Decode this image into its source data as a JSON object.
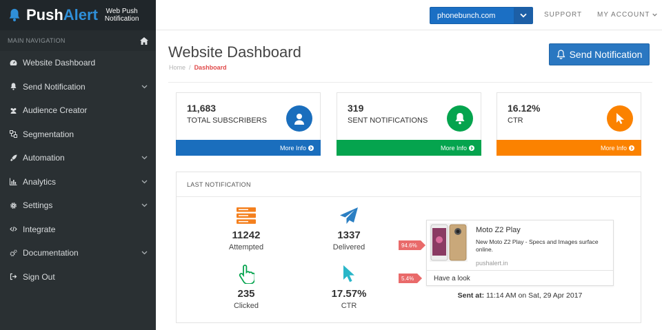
{
  "brand": {
    "push": "Push",
    "alert": "Alert",
    "tagline_1": "Web Push",
    "tagline_2": "Notification"
  },
  "nav": {
    "heading": "MAIN NAVIGATION",
    "items": [
      {
        "label": "Website Dashboard",
        "icon": "dashboard-icon"
      },
      {
        "label": "Send Notification",
        "icon": "bell-icon"
      },
      {
        "label": "Audience Creator",
        "icon": "users-icon"
      },
      {
        "label": "Segmentation",
        "icon": "segment-icon"
      },
      {
        "label": "Automation",
        "icon": "rocket-icon"
      },
      {
        "label": "Analytics",
        "icon": "bar-chart-icon"
      },
      {
        "label": "Settings",
        "icon": "gear-icon"
      },
      {
        "label": "Integrate",
        "icon": "code-icon"
      },
      {
        "label": "Documentation",
        "icon": "cogs-icon"
      },
      {
        "label": "Sign Out",
        "icon": "sign-out-icon"
      }
    ]
  },
  "topbar": {
    "site": "phonebunch.com",
    "support": "SUPPORT",
    "account": "MY ACCOUNT"
  },
  "page": {
    "title": "Website Dashboard",
    "crumb_home": "Home",
    "crumb_sep": "/",
    "crumb_active": "Dashboard",
    "send_button": "Send Notification"
  },
  "stats": [
    {
      "value": "11,683",
      "label": "TOTAL SUBSCRIBERS",
      "more": "More Info",
      "color": "#1a6ebd"
    },
    {
      "value": "319",
      "label": "SENT NOTIFICATIONS",
      "more": "More Info",
      "color": "#05a44e"
    },
    {
      "value": "16.12%",
      "label": "CTR",
      "more": "More Info",
      "color": "#fb8200"
    }
  ],
  "last": {
    "heading": "LAST NOTIFICATION",
    "metrics": [
      {
        "value": "11242",
        "label": "Attempted"
      },
      {
        "value": "1337",
        "label": "Delivered"
      },
      {
        "value": "235",
        "label": "Clicked"
      },
      {
        "value": "17.57%",
        "label": "CTR"
      }
    ],
    "notification": {
      "title": "Moto Z2 Play",
      "body": "New Moto Z2 Play - Specs and Images surface online.",
      "url": "pushalert.in",
      "action": "Have a look",
      "pct_main": "94.6%",
      "pct_action": "5.4%"
    },
    "sent_label": "Sent at:",
    "sent_value": "11:14 AM on Sat, 29 Apr 2017"
  }
}
